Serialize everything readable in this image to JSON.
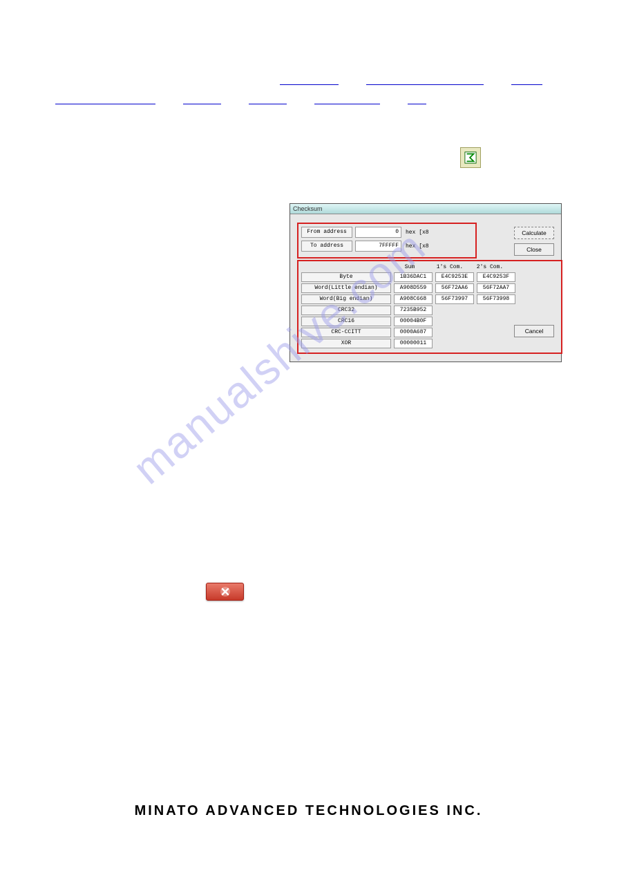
{
  "nav": {
    "line1": [
      "",
      "",
      ""
    ],
    "line2": [
      "",
      "",
      "",
      "",
      ""
    ]
  },
  "icon": {
    "name": "sigma-icon"
  },
  "checksum": {
    "title": "Checksum",
    "from_label": "From address",
    "from_value": "0",
    "from_suffix": "hex [x8",
    "to_label": "To address",
    "to_value": "7FFFFF",
    "to_suffix": "hex [x8",
    "headers": {
      "sum": "Sum",
      "com1": "1's Com.",
      "com2": "2's Com."
    },
    "rows": [
      {
        "label": "Byte",
        "sum": "1B36DAC1",
        "com1": "E4C9253E",
        "com2": "E4C9253F"
      },
      {
        "label": "Word(Little endian)",
        "sum": "A908D559",
        "com1": "56F72AA6",
        "com2": "56F72AA7"
      },
      {
        "label": "Word(Big endian)",
        "sum": "A908C668",
        "com1": "56F73997",
        "com2": "56F73998"
      },
      {
        "label": "CRC32",
        "sum": "7235B952",
        "com1": "",
        "com2": ""
      },
      {
        "label": "CRC16",
        "sum": "00004B0F",
        "com1": "",
        "com2": ""
      },
      {
        "label": "CRC-CCITT",
        "sum": "0000A687",
        "com1": "",
        "com2": ""
      },
      {
        "label": "XOR",
        "sum": "00000011",
        "com1": "",
        "com2": ""
      }
    ],
    "buttons": {
      "calculate": "Calculate",
      "close": "Close",
      "cancel": "Cancel"
    }
  },
  "watermark": "manualshive.com",
  "footer": "MINATO ADVANCED TECHNOLOGIES INC."
}
